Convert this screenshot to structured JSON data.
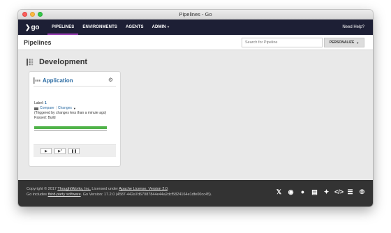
{
  "window": {
    "title": "Pipelines - Go"
  },
  "nav": {
    "logo": "go",
    "items": [
      {
        "label": "PIPELINES"
      },
      {
        "label": "ENVIRONMENTS"
      },
      {
        "label": "AGENTS"
      },
      {
        "label": "ADMIN"
      }
    ],
    "help": "Need Help?",
    "active_color": "#943bb0"
  },
  "page": {
    "title": "Pipelines"
  },
  "search": {
    "placeholder": "Search for Pipeline"
  },
  "personalize": {
    "label": "PERSONALIZE"
  },
  "group": {
    "name": "Development",
    "pipelines": [
      {
        "name": "Application",
        "label_prefix": "Label: ",
        "label_value": "1",
        "compare": "Compare",
        "changes": "Changes",
        "trigger": "(Triggered by changes less than a minute ago)",
        "status": "Passed: Build",
        "progress_fraction": 1.0,
        "status_color": "#50b349",
        "actions": [
          {
            "label": "▶",
            "icon": "play-icon"
          },
          {
            "label": "▶*",
            "icon": "play-with-options-icon"
          },
          {
            "label": "❚❚",
            "icon": "pause-icon"
          }
        ]
      }
    ]
  },
  "footer": {
    "line1_a": "Copyright © 2017 ",
    "line1_link1": "ThoughtWorks, Inc.",
    "line1_b": " Licensed under ",
    "line1_link2": "Apache License, Version 2.0",
    "line1_c": ".",
    "line2_a": "Go includes ",
    "line2_link": "third-party software",
    "line2_b": ". Go Version: 17.2.0 (4587-442a7d67087844e44a2dcf5824164e1dfe00cc45).",
    "social_icons": [
      "twitter-icon",
      "github-icon",
      "chat-icon",
      "docs-icon",
      "plugin-icon",
      "code-icon",
      "server-icon",
      "rss-icon"
    ]
  }
}
